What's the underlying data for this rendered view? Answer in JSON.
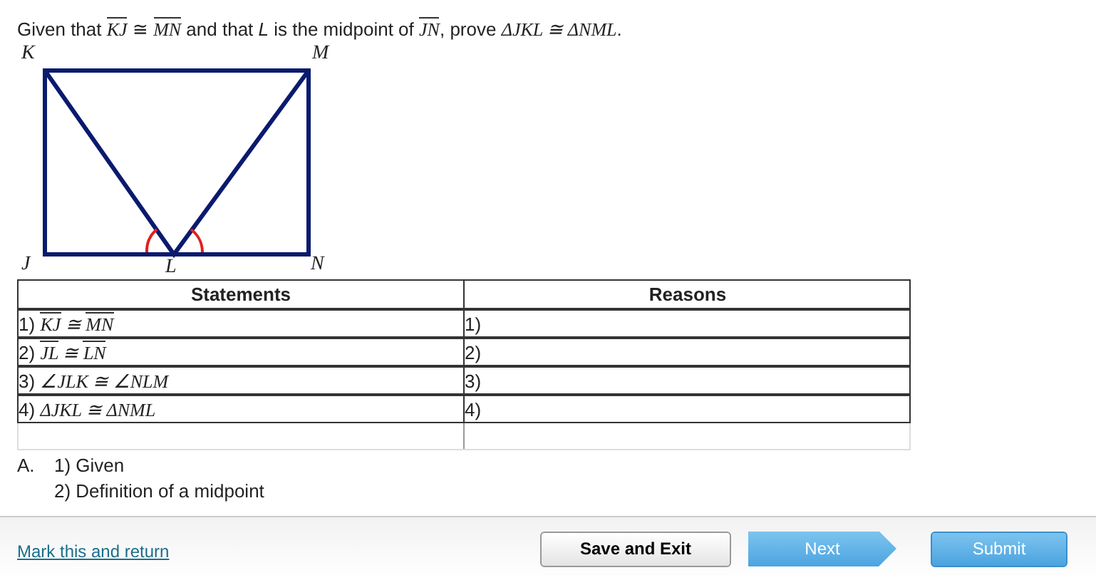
{
  "question": {
    "parts": [
      {
        "kind": "plain",
        "text": "Given that "
      },
      {
        "kind": "segment",
        "text": "KJ"
      },
      {
        "kind": "plain",
        "text": " ≅ "
      },
      {
        "kind": "segment",
        "text": "MN"
      },
      {
        "kind": "plain",
        "text": " and that "
      },
      {
        "kind": "italic",
        "text": "L"
      },
      {
        "kind": "plain",
        "text": " is the midpoint of "
      },
      {
        "kind": "segment",
        "text": "JN"
      },
      {
        "kind": "plain",
        "text": ", prove "
      },
      {
        "kind": "math",
        "text": "ΔJKL ≅ ΔNML"
      },
      {
        "kind": "plain",
        "text": "."
      }
    ]
  },
  "diagram": {
    "labels": [
      "K",
      "M",
      "J",
      "L",
      "N"
    ]
  },
  "table": {
    "columns": [
      "Statements",
      "Reasons"
    ],
    "rows": [
      {
        "number": "1)",
        "reason": "1)",
        "statement": [
          {
            "kind": "segment",
            "text": "KJ"
          },
          {
            "kind": "math",
            "text": " ≅ "
          },
          {
            "kind": "segment",
            "text": "MN"
          }
        ]
      },
      {
        "number": "2)",
        "reason": "2)",
        "statement": [
          {
            "kind": "segment",
            "text": "JL"
          },
          {
            "kind": "math",
            "text": " ≅ "
          },
          {
            "kind": "segment",
            "text": "LN"
          }
        ]
      },
      {
        "number": "3)",
        "reason": "3)",
        "statement": [
          {
            "kind": "math",
            "text": "∠JLK ≅ ∠NLM"
          }
        ]
      },
      {
        "number": "4)",
        "reason": "4)",
        "statement": [
          {
            "kind": "math",
            "text": "ΔJKL ≅ ΔNML"
          }
        ]
      }
    ]
  },
  "choice": {
    "letter": "A.",
    "lines": [
      "1) Given",
      "2) Definition of a midpoint"
    ]
  },
  "footer": {
    "link": "Mark this and return",
    "buttons": [
      "Save and Exit",
      "Next",
      "Submit"
    ]
  }
}
